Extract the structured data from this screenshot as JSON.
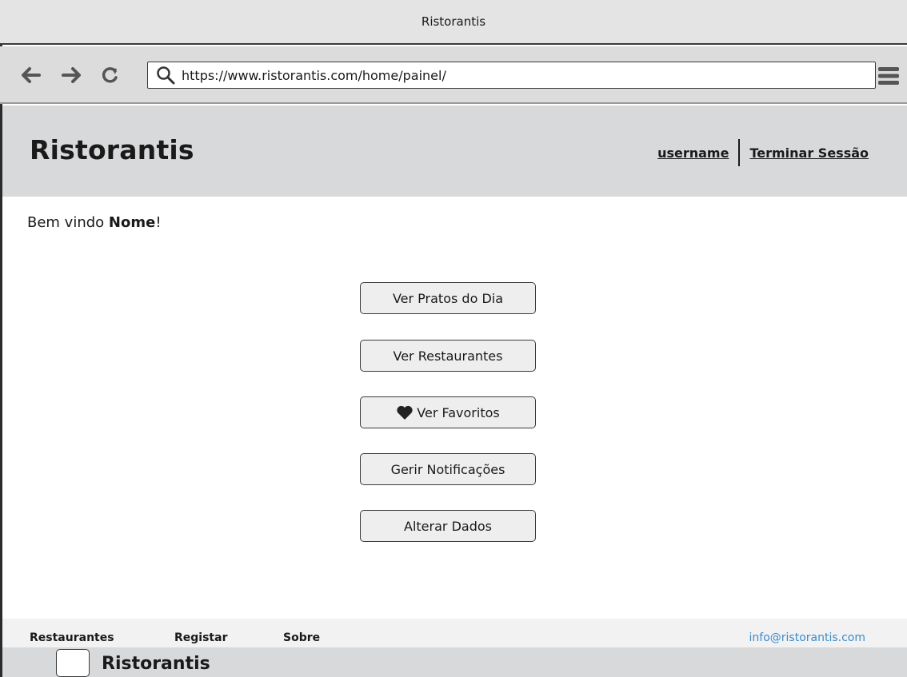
{
  "window": {
    "title": "Ristorantis"
  },
  "browser": {
    "url": "https://www.ristorantis.com/home/painel/",
    "icons": {
      "back": "arrow-left-icon",
      "forward": "arrow-right-icon",
      "reload": "reload-icon",
      "search": "search-icon",
      "menu": "hamburger-menu-icon"
    }
  },
  "header": {
    "brand": "Ristorantis",
    "username_link": "username",
    "logout_link": "Terminar Sessão"
  },
  "welcome": {
    "prefix": "Bem vindo ",
    "name": "Nome",
    "suffix": "!"
  },
  "actions": [
    {
      "label": "Ver Pratos do Dia"
    },
    {
      "label": "Ver Restaurantes"
    },
    {
      "label": "Ver Favoritos",
      "icon": "heart-icon"
    },
    {
      "label": "Gerir Notificações"
    },
    {
      "label": "Alterar Dados"
    }
  ],
  "footer": {
    "links": [
      "Restaurantes",
      "Registar",
      "Sobre"
    ],
    "email": "info@ristorantis.com",
    "brand": "Ristorantis"
  },
  "colors": {
    "header_bg": "#d8d9db",
    "email_link": "#3a8cd0"
  }
}
